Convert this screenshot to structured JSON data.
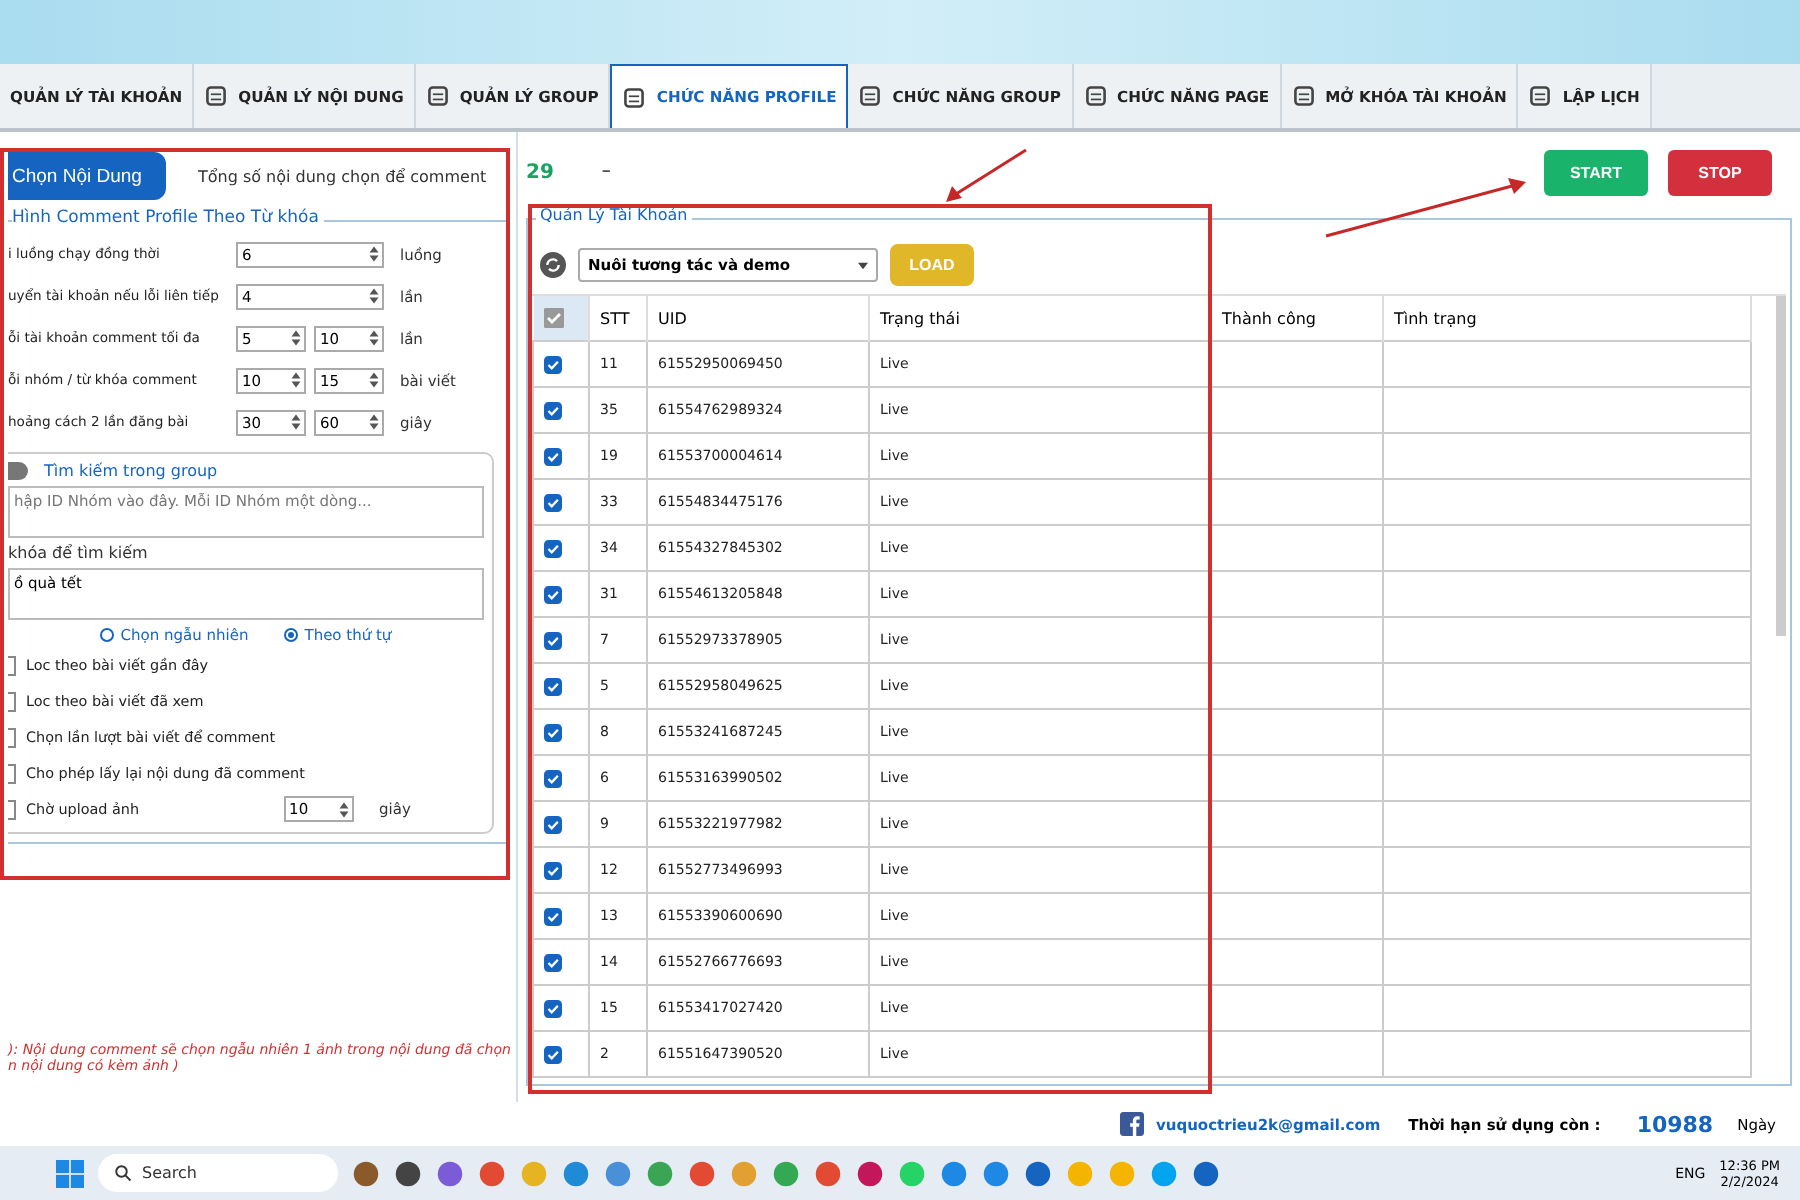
{
  "tabs": [
    {
      "label": "QUẢN LÝ TÀI KHOẢN",
      "selected": false
    },
    {
      "label": "QUẢN LÝ NỘI DUNG",
      "selected": false
    },
    {
      "label": "QUẢN LÝ GROUP",
      "selected": false
    },
    {
      "label": "CHỨC NĂNG PROFILE",
      "selected": true
    },
    {
      "label": "CHỨC NĂNG GROUP",
      "selected": false
    },
    {
      "label": "CHỨC NĂNG PAGE",
      "selected": false
    },
    {
      "label": "MỞ KHÓA TÀI KHOẢN",
      "selected": false
    },
    {
      "label": "LẬP LỊCH",
      "selected": false
    }
  ],
  "content_bar": {
    "button": "Chọn Nội Dung",
    "label": "Tổng số nội dung chọn để comment",
    "count": "29",
    "dash": "–"
  },
  "settings": {
    "title": "Hình Comment Profile Theo Từ khóa",
    "rows": [
      {
        "label": "i luồng chạy đồng thời",
        "values": [
          "6"
        ],
        "unit": "luồng"
      },
      {
        "label": "uyển tài khoản nếu lỗi liên tiếp",
        "values": [
          "4"
        ],
        "unit": "lần"
      },
      {
        "label": "ỗi tài khoản comment tối đa",
        "values": [
          "5",
          "10"
        ],
        "unit": "lần"
      },
      {
        "label": "ỗi nhóm / từ khóa comment",
        "values": [
          "10",
          "15"
        ],
        "unit": "bài viết"
      },
      {
        "label": "hoảng cách 2 lần đăng bài",
        "values": [
          "30",
          "60"
        ],
        "unit": "giây"
      }
    ],
    "group_search": {
      "label": "Tìm kiếm trong group",
      "on": false,
      "placeholder": "hập ID Nhóm vào đây. Mỗi ID Nhóm một dòng..."
    },
    "keyword_label": "khóa để tìm kiếm",
    "keyword_value": "ồ quà tết",
    "radios": [
      {
        "label": "Chọn ngẫu nhiên",
        "selected": false
      },
      {
        "label": "Theo thứ tự",
        "selected": true
      }
    ],
    "options": [
      {
        "label": "Loc theo bài viết gần đây",
        "checked": false
      },
      {
        "label": "Loc theo bài viết đã xem",
        "checked": false
      },
      {
        "label": "Chọn lần lượt bài viết để comment",
        "checked": false
      },
      {
        "label": "Cho phép lấy lại nội dung đã comment",
        "checked": false
      },
      {
        "label": "Chờ upload ảnh",
        "checked": false,
        "value": "10",
        "unit": "giây"
      }
    ],
    "note": [
      "): Nội dung comment sẽ chọn ngẫu nhiên 1 ảnh trong nội dung đã chọn",
      "n nội dung có kèm ảnh )"
    ]
  },
  "buttons": {
    "start": "START",
    "stop": "STOP"
  },
  "accounts": {
    "title": "Quản Lý Tài Khoản",
    "dropdown": "Nuôi tương  tác và demo",
    "load": "LOAD",
    "all_checked": true,
    "columns": [
      "STT",
      "UID",
      "Trạng thái",
      "Thành công",
      "Tình trạng"
    ],
    "rows": [
      {
        "checked": true,
        "stt": "11",
        "uid": "61552950069450",
        "status": "Live"
      },
      {
        "checked": true,
        "stt": "35",
        "uid": "61554762989324",
        "status": "Live"
      },
      {
        "checked": true,
        "stt": "19",
        "uid": "61553700004614",
        "status": "Live"
      },
      {
        "checked": true,
        "stt": "33",
        "uid": "61554834475176",
        "status": "Live"
      },
      {
        "checked": true,
        "stt": "34",
        "uid": "61554327845302",
        "status": "Live"
      },
      {
        "checked": true,
        "stt": "31",
        "uid": "61554613205848",
        "status": "Live"
      },
      {
        "checked": true,
        "stt": "7",
        "uid": "61552973378905",
        "status": "Live"
      },
      {
        "checked": true,
        "stt": "5",
        "uid": "61552958049625",
        "status": "Live"
      },
      {
        "checked": true,
        "stt": "8",
        "uid": "61553241687245",
        "status": "Live"
      },
      {
        "checked": true,
        "stt": "6",
        "uid": "61553163990502",
        "status": "Live"
      },
      {
        "checked": true,
        "stt": "9",
        "uid": "61553221977982",
        "status": "Live"
      },
      {
        "checked": true,
        "stt": "12",
        "uid": "61552773496993",
        "status": "Live"
      },
      {
        "checked": true,
        "stt": "13",
        "uid": "61553390600690",
        "status": "Live"
      },
      {
        "checked": true,
        "stt": "14",
        "uid": "61552766776693",
        "status": "Live"
      },
      {
        "checked": true,
        "stt": "15",
        "uid": "61553417027420",
        "status": "Live"
      },
      {
        "checked": true,
        "stt": "2",
        "uid": "61551647390520",
        "status": "Live"
      }
    ]
  },
  "footer": {
    "email": "vuquoctrieu2k@gmail.com",
    "expiry_label": "Thời hạn sử dụng còn :",
    "expiry_value": "10988",
    "expiry_unit": "Ngày"
  },
  "taskbar": {
    "search": "Search",
    "language": "ENG",
    "time": "12:36 PM",
    "date": "2/2/2024"
  }
}
